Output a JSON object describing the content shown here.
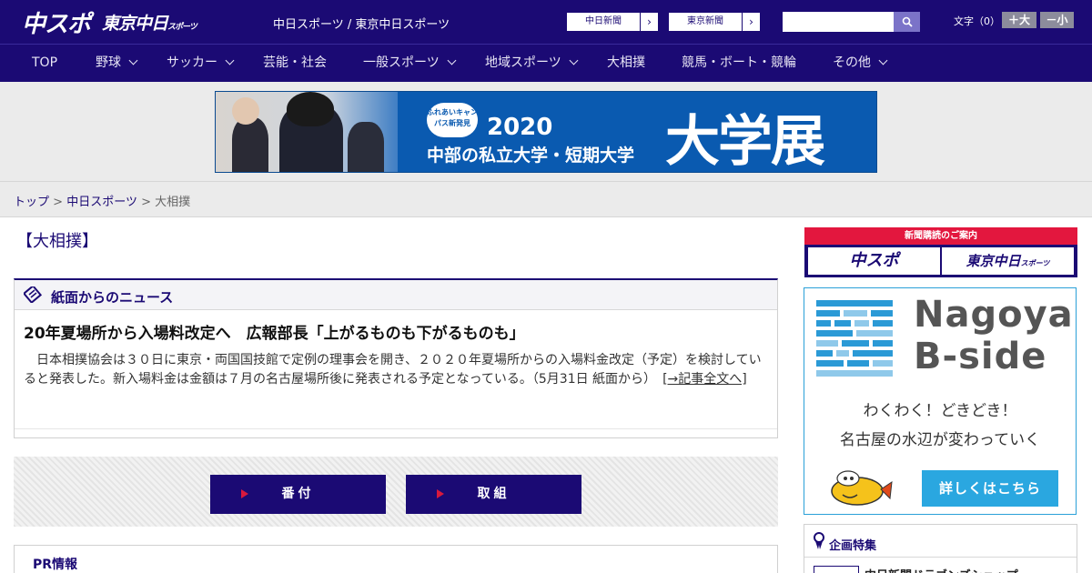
{
  "header": {
    "logo_chuspo": "中スポ",
    "logo_tokyo": "東京中日",
    "logo_tokyo_suffix": "スポーツ",
    "site_name": "中日スポーツ / 東京中日スポーツ",
    "paper_links": [
      {
        "label": "中日新聞"
      },
      {
        "label": "東京新聞"
      }
    ],
    "search_placeholder": "",
    "font_size_label": "文字（0）",
    "font_bigger": "＋大",
    "font_smaller": "－小"
  },
  "nav": {
    "items": [
      {
        "label": "TOP",
        "has_menu": false
      },
      {
        "label": "野球",
        "has_menu": true
      },
      {
        "label": "サッカー",
        "has_menu": true
      },
      {
        "label": "芸能・社会",
        "has_menu": false
      },
      {
        "label": "一般スポーツ",
        "has_menu": true
      },
      {
        "label": "地域スポーツ",
        "has_menu": true
      },
      {
        "label": "大相撲",
        "has_menu": false
      },
      {
        "label": "競馬・ボート・競輪",
        "has_menu": false
      },
      {
        "label": "その他",
        "has_menu": true
      }
    ]
  },
  "ad": {
    "badge": "ふれあいキャンパス新発見",
    "year": "2020",
    "subtitle": "中部の私立大学・短期大学",
    "big": "大学展"
  },
  "breadcrumb": {
    "top": "トップ",
    "section": "中日スポーツ",
    "current": "大相撲",
    "sep": ">"
  },
  "main": {
    "page_title": "【大相撲】",
    "news_box_title": "紙面からのニュース",
    "headline": "20年夏場所から入場料改定へ　広報部長「上がるものも下がるものも」",
    "summary": "　日本相撲協会は３０日に東京・両国国技館で定例の理事会を開き、２０２０年夏場所からの入場料金改定（予定）を検討していると発表した。新入場料金は金額は７月の名古屋場所後に発表される予定となっている。（5月31日 紙面から）　",
    "more_link": "[→記事全文へ]",
    "button_banzuke": "番付",
    "button_torikumi": "取組",
    "pr_title": "PR情報"
  },
  "sidebar": {
    "subscribe_title": "新聞購読のご案内",
    "subscribe_chuspo": "中スポ",
    "subscribe_tokyo": "東京中日",
    "subscribe_tokyo_suffix": "スポーツ",
    "nb_title1": "Nagoya",
    "nb_title2": "B-side",
    "nb_line1": "わくわく！どきどき！",
    "nb_line2": "名古屋の水辺が変わっていく",
    "nb_button": "詳しくはこちら",
    "kikaku_title": "企画特集",
    "kikaku_item": "中日新聞ドラゴンズショップ"
  },
  "colors": {
    "brand_navy": "#1b0a74",
    "accent_red": "#e3173e",
    "accent_blue": "#2aa7e0"
  }
}
